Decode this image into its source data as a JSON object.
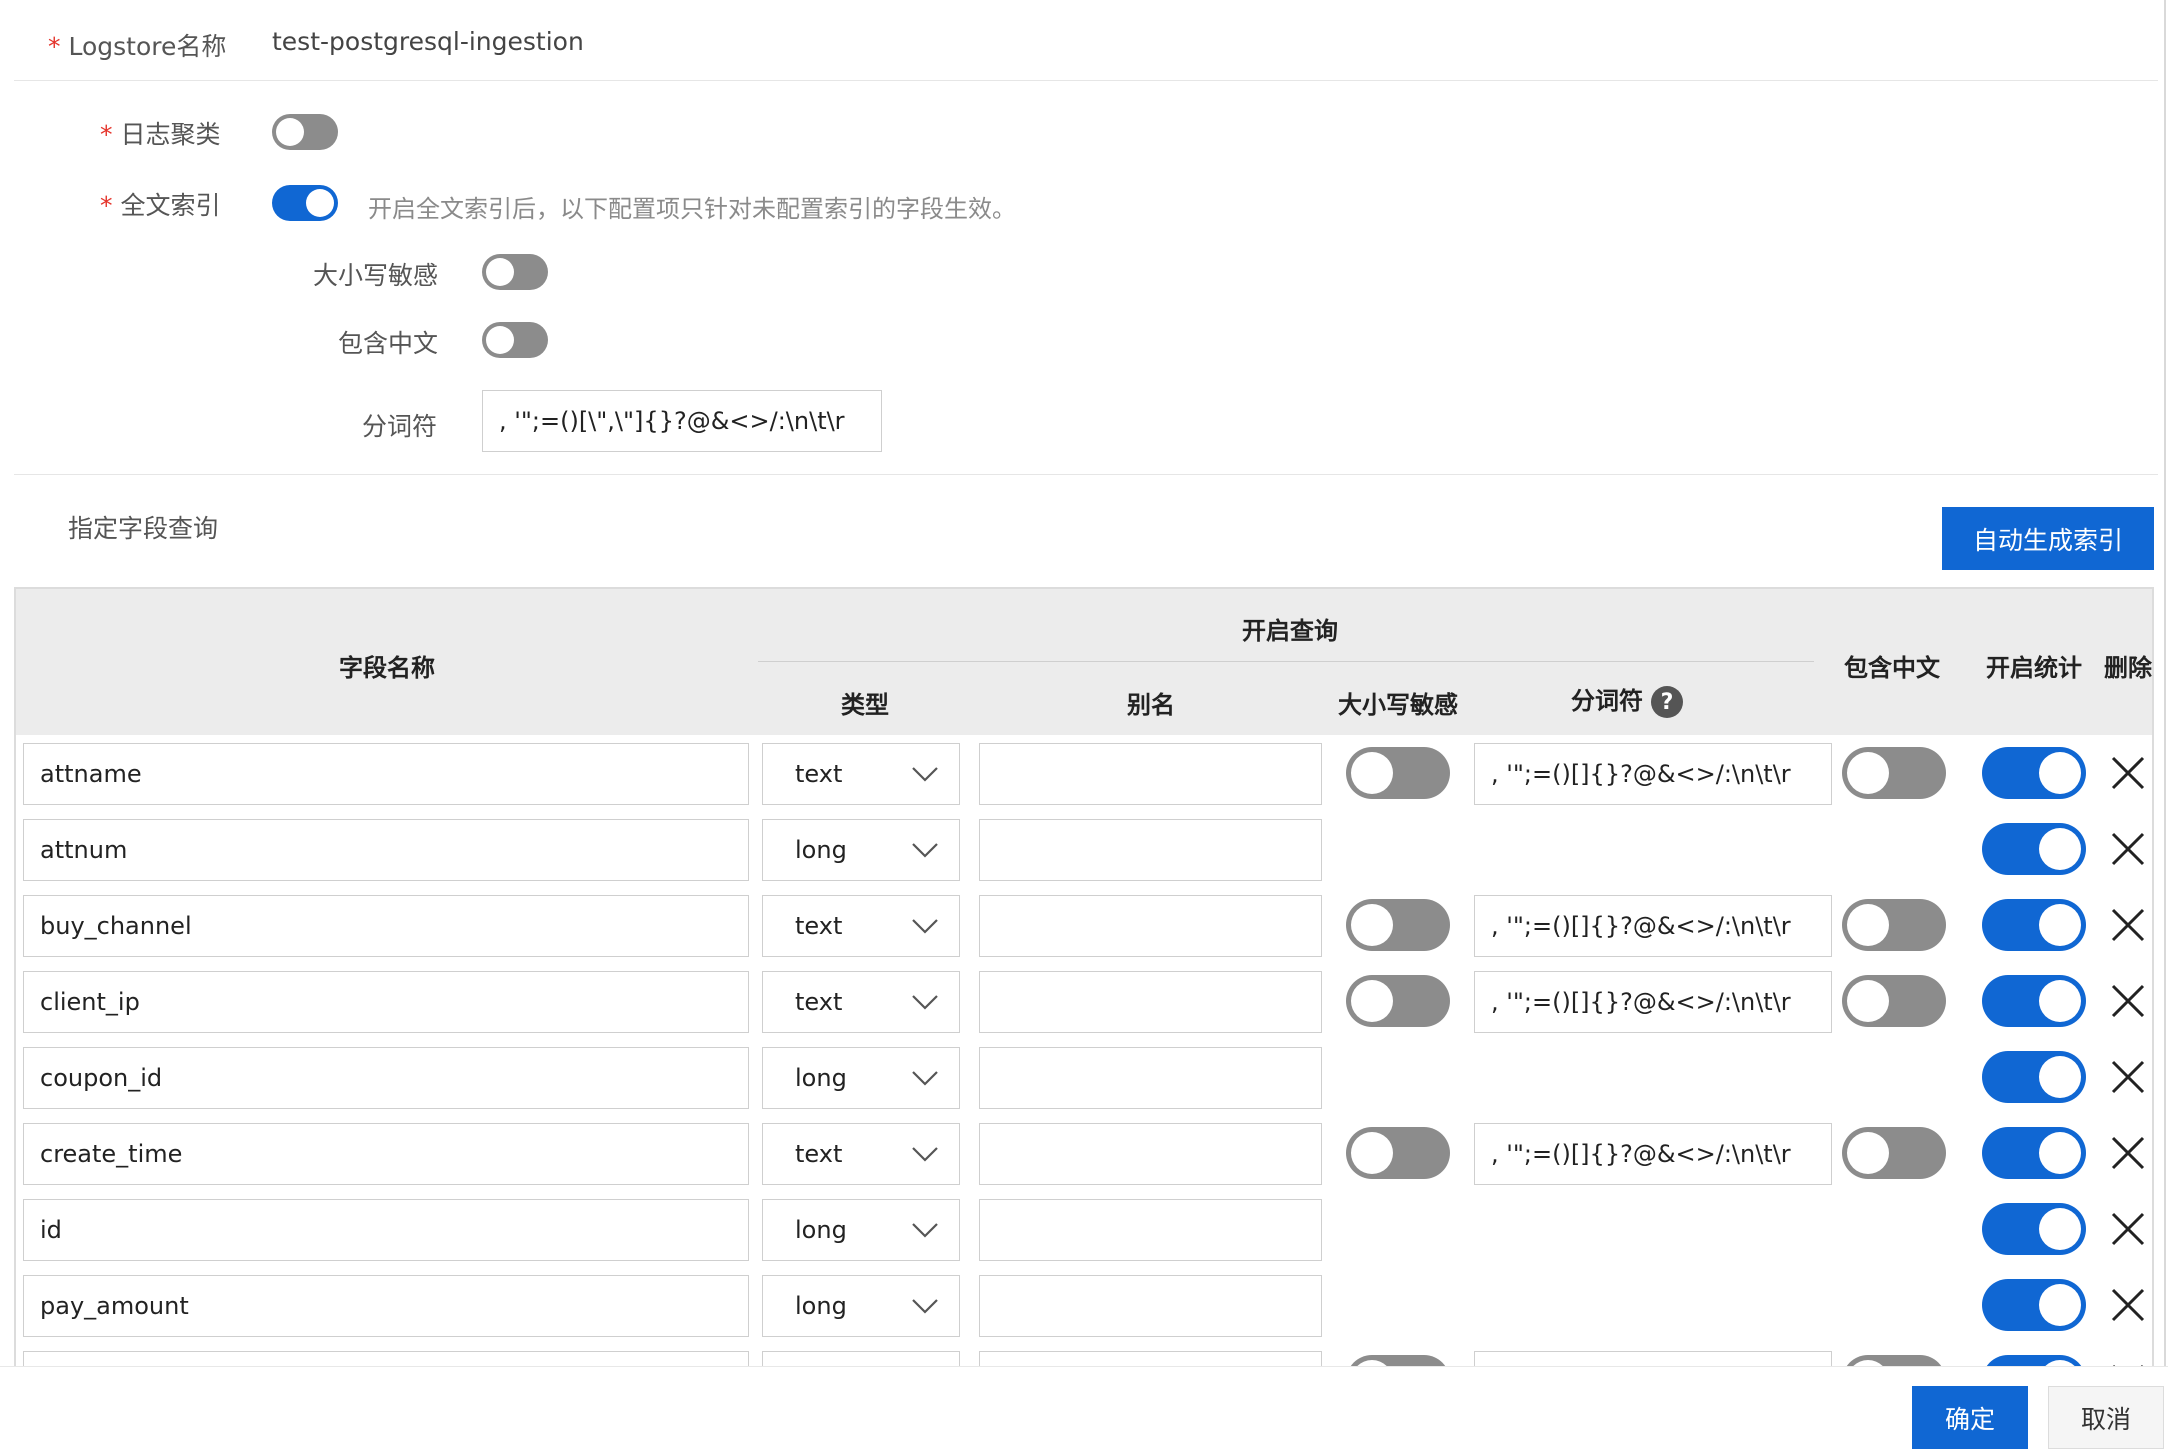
{
  "form": {
    "logstore_label": "Logstore名称",
    "logstore_value": "test-postgresql-ingestion",
    "log_cluster_label": "日志聚类",
    "log_cluster_on": false,
    "fulltext_label": "全文索引",
    "fulltext_on": true,
    "fulltext_hint": "开启全文索引后，以下配置项只针对未配置索引的字段生效。",
    "case_sensitive_label": "大小写敏感",
    "case_sensitive_on": false,
    "include_chinese_label": "包含中文",
    "include_chinese_on": false,
    "delimiter_label": "分词符",
    "delimiter_value": ", '\";=()[\\\",\\\"]{}?@&<>/:\\n\\t\\r"
  },
  "field_query": {
    "title": "指定字段查询",
    "auto_button": "自动生成索引"
  },
  "table": {
    "headers": {
      "field_name": "字段名称",
      "enable_query": "开启查询",
      "type": "类型",
      "alias": "别名",
      "case_sensitive": "大小写敏感",
      "delimiter": "分词符",
      "include_chinese": "包含中文",
      "enable_stats": "开启统计",
      "delete": "删除"
    },
    "rows": [
      {
        "name": "attname",
        "type": "text",
        "alias": "",
        "case_sensitive": false,
        "delimiter": ", '\";=()[]{}?@&<>/:\\n\\t\\r",
        "include_chinese": false,
        "stats": true
      },
      {
        "name": "attnum",
        "type": "long",
        "alias": "",
        "stats": true
      },
      {
        "name": "buy_channel",
        "type": "text",
        "alias": "",
        "case_sensitive": false,
        "delimiter": ", '\";=()[]{}?@&<>/:\\n\\t\\r",
        "include_chinese": false,
        "stats": true
      },
      {
        "name": "client_ip",
        "type": "text",
        "alias": "",
        "case_sensitive": false,
        "delimiter": ", '\";=()[]{}?@&<>/:\\n\\t\\r",
        "include_chinese": false,
        "stats": true
      },
      {
        "name": "coupon_id",
        "type": "long",
        "alias": "",
        "stats": true
      },
      {
        "name": "create_time",
        "type": "text",
        "alias": "",
        "case_sensitive": false,
        "delimiter": ", '\";=()[]{}?@&<>/:\\n\\t\\r",
        "include_chinese": false,
        "stats": true
      },
      {
        "name": "id",
        "type": "long",
        "alias": "",
        "stats": true
      },
      {
        "name": "pay_amount",
        "type": "long",
        "alias": "",
        "stats": true
      },
      {
        "name": "",
        "type": "",
        "alias": "",
        "case_sensitive": false,
        "delimiter": "",
        "include_chinese": false,
        "stats": true
      }
    ]
  },
  "footer": {
    "ok_button": "确定",
    "cancel_button": "取消"
  },
  "colors": {
    "primary": "#1067d3",
    "toggle_off": "#8c8c8c",
    "required": "#e5332a"
  }
}
